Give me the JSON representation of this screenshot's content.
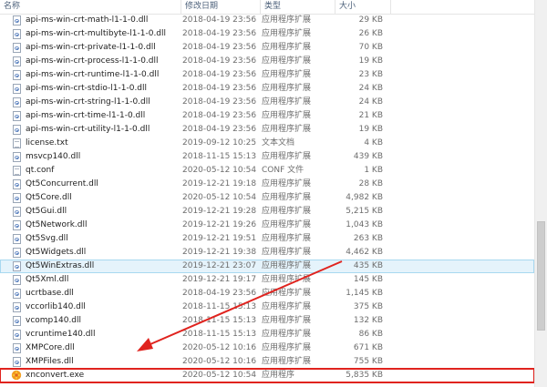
{
  "columns": {
    "name": "名称",
    "date": "修改日期",
    "type": "类型",
    "size": "大小"
  },
  "files": [
    {
      "name": "api-ms-win-crt-math-l1-1-0.dll",
      "date": "2018-04-19 23:56",
      "type": "应用程序扩展",
      "size": "29 KB",
      "icon": "dll"
    },
    {
      "name": "api-ms-win-crt-multibyte-l1-1-0.dll",
      "date": "2018-04-19 23:56",
      "type": "应用程序扩展",
      "size": "26 KB",
      "icon": "dll"
    },
    {
      "name": "api-ms-win-crt-private-l1-1-0.dll",
      "date": "2018-04-19 23:56",
      "type": "应用程序扩展",
      "size": "70 KB",
      "icon": "dll"
    },
    {
      "name": "api-ms-win-crt-process-l1-1-0.dll",
      "date": "2018-04-19 23:56",
      "type": "应用程序扩展",
      "size": "19 KB",
      "icon": "dll"
    },
    {
      "name": "api-ms-win-crt-runtime-l1-1-0.dll",
      "date": "2018-04-19 23:56",
      "type": "应用程序扩展",
      "size": "23 KB",
      "icon": "dll"
    },
    {
      "name": "api-ms-win-crt-stdio-l1-1-0.dll",
      "date": "2018-04-19 23:56",
      "type": "应用程序扩展",
      "size": "24 KB",
      "icon": "dll"
    },
    {
      "name": "api-ms-win-crt-string-l1-1-0.dll",
      "date": "2018-04-19 23:56",
      "type": "应用程序扩展",
      "size": "24 KB",
      "icon": "dll"
    },
    {
      "name": "api-ms-win-crt-time-l1-1-0.dll",
      "date": "2018-04-19 23:56",
      "type": "应用程序扩展",
      "size": "21 KB",
      "icon": "dll"
    },
    {
      "name": "api-ms-win-crt-utility-l1-1-0.dll",
      "date": "2018-04-19 23:56",
      "type": "应用程序扩展",
      "size": "19 KB",
      "icon": "dll"
    },
    {
      "name": "license.txt",
      "date": "2019-09-12 10:25",
      "type": "文本文档",
      "size": "4 KB",
      "icon": "txt"
    },
    {
      "name": "msvcp140.dll",
      "date": "2018-11-15 15:13",
      "type": "应用程序扩展",
      "size": "439 KB",
      "icon": "dll"
    },
    {
      "name": "qt.conf",
      "date": "2020-05-12 10:54",
      "type": "CONF 文件",
      "size": "1 KB",
      "icon": "txt"
    },
    {
      "name": "Qt5Concurrent.dll",
      "date": "2019-12-21 19:18",
      "type": "应用程序扩展",
      "size": "28 KB",
      "icon": "dll"
    },
    {
      "name": "Qt5Core.dll",
      "date": "2020-05-12 10:54",
      "type": "应用程序扩展",
      "size": "4,982 KB",
      "icon": "dll"
    },
    {
      "name": "Qt5Gui.dll",
      "date": "2019-12-21 19:28",
      "type": "应用程序扩展",
      "size": "5,215 KB",
      "icon": "dll"
    },
    {
      "name": "Qt5Network.dll",
      "date": "2019-12-21 19:26",
      "type": "应用程序扩展",
      "size": "1,043 KB",
      "icon": "dll"
    },
    {
      "name": "Qt5Svg.dll",
      "date": "2019-12-21 19:51",
      "type": "应用程序扩展",
      "size": "263 KB",
      "icon": "dll"
    },
    {
      "name": "Qt5Widgets.dll",
      "date": "2019-12-21 19:38",
      "type": "应用程序扩展",
      "size": "4,462 KB",
      "icon": "dll"
    },
    {
      "name": "Qt5WinExtras.dll",
      "date": "2019-12-21 23:07",
      "type": "应用程序扩展",
      "size": "435 KB",
      "icon": "dll",
      "hover": true
    },
    {
      "name": "Qt5Xml.dll",
      "date": "2019-12-21 19:17",
      "type": "应用程序扩展",
      "size": "145 KB",
      "icon": "dll"
    },
    {
      "name": "ucrtbase.dll",
      "date": "2018-04-19 23:56",
      "type": "应用程序扩展",
      "size": "1,145 KB",
      "icon": "dll"
    },
    {
      "name": "vccorlib140.dll",
      "date": "2018-11-15 15:13",
      "type": "应用程序扩展",
      "size": "375 KB",
      "icon": "dll"
    },
    {
      "name": "vcomp140.dll",
      "date": "2018-11-15 15:13",
      "type": "应用程序扩展",
      "size": "132 KB",
      "icon": "dll"
    },
    {
      "name": "vcruntime140.dll",
      "date": "2018-11-15 15:13",
      "type": "应用程序扩展",
      "size": "86 KB",
      "icon": "dll"
    },
    {
      "name": "XMPCore.dll",
      "date": "2020-05-12 10:16",
      "type": "应用程序扩展",
      "size": "671 KB",
      "icon": "dll"
    },
    {
      "name": "XMPFiles.dll",
      "date": "2020-05-12 10:16",
      "type": "应用程序扩展",
      "size": "755 KB",
      "icon": "dll"
    },
    {
      "name": "xnconvert.exe",
      "date": "2020-05-12 10:54",
      "type": "应用程序",
      "size": "5,835 KB",
      "icon": "exe",
      "highlighted": true
    }
  ],
  "colors": {
    "annotation": "#e0231e",
    "hover": "#e5f3fb",
    "header_text": "#4c607a"
  },
  "icons": {
    "dll": "dll-file-icon",
    "txt": "text-file-icon",
    "exe": "xnconvert-app-icon"
  }
}
